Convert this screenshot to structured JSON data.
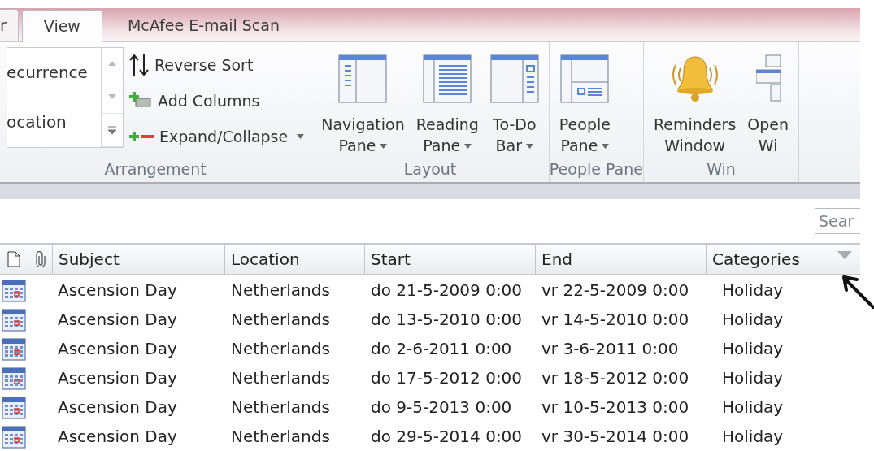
{
  "tabs": [
    {
      "label": "r",
      "selected": false
    },
    {
      "label": "View",
      "selected": true
    },
    {
      "label": "McAfee E-mail Scan",
      "selected": false
    }
  ],
  "ribbon": {
    "groups": [
      {
        "kind": "arrangement",
        "label": "Arrangement",
        "gallery": [
          "ecurrence",
          "ocation"
        ],
        "commands": [
          {
            "kind": "sort",
            "label": "Reverse Sort",
            "dropdown": false
          },
          {
            "kind": "add",
            "label": "Add Columns",
            "dropdown": false
          },
          {
            "kind": "expand",
            "label": "Expand/Collapse",
            "dropdown": true
          }
        ]
      },
      {
        "kind": "large",
        "label": "Layout",
        "buttons": [
          {
            "kind": "nav",
            "lines": [
              "Navigation",
              "Pane"
            ],
            "dropdown": true
          },
          {
            "kind": "reading",
            "lines": [
              "Reading",
              "Pane"
            ],
            "dropdown": true
          },
          {
            "kind": "todo",
            "lines": [
              "To-Do",
              "Bar"
            ],
            "dropdown": true
          }
        ]
      },
      {
        "kind": "large",
        "label": "People Pane",
        "buttons": [
          {
            "kind": "people",
            "lines": [
              "People",
              "Pane"
            ],
            "dropdown": true
          }
        ]
      },
      {
        "kind": "large",
        "label": "Win",
        "buttons": [
          {
            "kind": "bell",
            "lines": [
              "Reminders",
              "Window"
            ],
            "dropdown": false
          },
          {
            "kind": "windows",
            "lines": [
              "Open",
              "Wi"
            ],
            "dropdown": false
          }
        ]
      }
    ]
  },
  "search": {
    "placeholder": "Sear"
  },
  "table": {
    "columns": [
      "Subject",
      "Location",
      "Start",
      "End",
      "Categories"
    ],
    "rows": [
      {
        "subject": "Ascension Day",
        "location": "Netherlands",
        "start": "do 21-5-2009 0:00",
        "end": "vr 22-5-2009 0:00",
        "categories": "Holiday"
      },
      {
        "subject": "Ascension Day",
        "location": "Netherlands",
        "start": "do 13-5-2010 0:00",
        "end": "vr 14-5-2010 0:00",
        "categories": "Holiday"
      },
      {
        "subject": "Ascension Day",
        "location": "Netherlands",
        "start": "do 2-6-2011 0:00",
        "end": "vr 3-6-2011 0:00",
        "categories": "Holiday"
      },
      {
        "subject": "Ascension Day",
        "location": "Netherlands",
        "start": "do 17-5-2012 0:00",
        "end": "vr 18-5-2012 0:00",
        "categories": "Holiday"
      },
      {
        "subject": "Ascension Day",
        "location": "Netherlands",
        "start": "do 9-5-2013 0:00",
        "end": "vr 10-5-2013 0:00",
        "categories": "Holiday"
      },
      {
        "subject": "Ascension Day",
        "location": "Netherlands",
        "start": "do 29-5-2014 0:00",
        "end": "vr 30-5-2014 0:00",
        "categories": "Holiday"
      }
    ]
  }
}
